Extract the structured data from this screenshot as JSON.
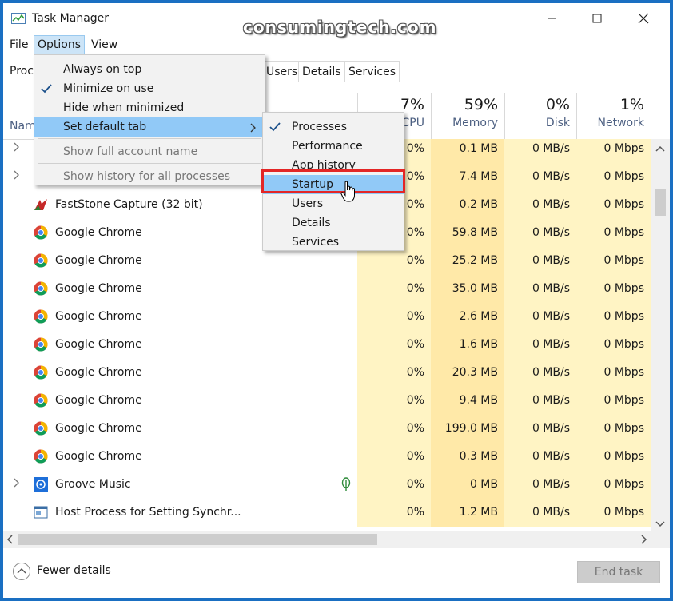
{
  "window": {
    "title": "Task Manager"
  },
  "watermark": "consumingtech.com",
  "menubar": {
    "file": "File",
    "options": "Options",
    "view": "View"
  },
  "tabs": [
    "Proc",
    "Users",
    "Details",
    "Services"
  ],
  "columns": {
    "name": "Nam",
    "cpu": {
      "pct": "7%",
      "label": "CPU"
    },
    "memory": {
      "pct": "59%",
      "label": "Memory"
    },
    "disk": {
      "pct": "0%",
      "label": "Disk"
    },
    "network": {
      "pct": "1%",
      "label": "Network"
    }
  },
  "rows": [
    {
      "name": "",
      "cpu": "0%",
      "mem": "0.1 MB",
      "disk": "0 MB/s",
      "net": "0 Mbps",
      "icon": "",
      "expand": true
    },
    {
      "name": "",
      "cpu": "0%",
      "mem": "7.4 MB",
      "disk": "0 MB/s",
      "net": "0 Mbps",
      "icon": "",
      "expand": true
    },
    {
      "name": "FastStone Capture (32 bit)",
      "cpu": "0%",
      "mem": "0.2 MB",
      "disk": "0 MB/s",
      "net": "0 Mbps",
      "icon": "faststone-icon",
      "expand": false
    },
    {
      "name": "Google Chrome",
      "cpu": "0%",
      "mem": "59.8 MB",
      "disk": "0 MB/s",
      "net": "0 Mbps",
      "icon": "chrome-icon",
      "expand": false
    },
    {
      "name": "Google Chrome",
      "cpu": "0%",
      "mem": "25.2 MB",
      "disk": "0 MB/s",
      "net": "0 Mbps",
      "icon": "chrome-icon",
      "expand": false
    },
    {
      "name": "Google Chrome",
      "cpu": "0%",
      "mem": "35.0 MB",
      "disk": "0 MB/s",
      "net": "0 Mbps",
      "icon": "chrome-icon",
      "expand": false
    },
    {
      "name": "Google Chrome",
      "cpu": "0%",
      "mem": "2.6 MB",
      "disk": "0 MB/s",
      "net": "0 Mbps",
      "icon": "chrome-icon",
      "expand": false
    },
    {
      "name": "Google Chrome",
      "cpu": "0%",
      "mem": "1.6 MB",
      "disk": "0 MB/s",
      "net": "0 Mbps",
      "icon": "chrome-icon",
      "expand": false
    },
    {
      "name": "Google Chrome",
      "cpu": "0%",
      "mem": "20.3 MB",
      "disk": "0 MB/s",
      "net": "0 Mbps",
      "icon": "chrome-icon",
      "expand": false
    },
    {
      "name": "Google Chrome",
      "cpu": "0%",
      "mem": "9.4 MB",
      "disk": "0 MB/s",
      "net": "0 Mbps",
      "icon": "chrome-icon",
      "expand": false
    },
    {
      "name": "Google Chrome",
      "cpu": "0%",
      "mem": "199.0 MB",
      "disk": "0 MB/s",
      "net": "0 Mbps",
      "icon": "chrome-icon",
      "expand": false
    },
    {
      "name": "Google Chrome",
      "cpu": "0%",
      "mem": "0.3 MB",
      "disk": "0 MB/s",
      "net": "0 Mbps",
      "icon": "chrome-icon",
      "expand": false
    },
    {
      "name": "Groove Music",
      "cpu": "0%",
      "mem": "0 MB",
      "disk": "0 MB/s",
      "net": "0 Mbps",
      "icon": "groove-icon",
      "expand": true,
      "leaf": true
    },
    {
      "name": "Host Process for Setting Synchr...",
      "cpu": "0%",
      "mem": "1.2 MB",
      "disk": "0 MB/s",
      "net": "0 Mbps",
      "icon": "host-process-icon",
      "expand": false
    }
  ],
  "options_menu": {
    "items": [
      {
        "label": "Always on top",
        "checked": false,
        "disabled": false
      },
      {
        "label": "Minimize on use",
        "checked": true,
        "disabled": false
      },
      {
        "label": "Hide when minimized",
        "checked": false,
        "disabled": false
      },
      {
        "label": "Set default tab",
        "checked": false,
        "disabled": false,
        "submenu": true,
        "highlighted": true
      },
      {
        "label": "Show full account name",
        "checked": false,
        "disabled": true
      },
      {
        "label": "Show history for all processes",
        "checked": false,
        "disabled": true
      }
    ]
  },
  "submenu": {
    "items": [
      {
        "label": "Processes",
        "checked": true
      },
      {
        "label": "Performance",
        "checked": false
      },
      {
        "label": "App history",
        "checked": false
      },
      {
        "label": "Startup",
        "checked": false,
        "highlighted": true
      },
      {
        "label": "Users",
        "checked": false
      },
      {
        "label": "Details",
        "checked": false
      },
      {
        "label": "Services",
        "checked": false
      }
    ]
  },
  "footer": {
    "fewer_details": "Fewer details",
    "end_task": "End task"
  },
  "colors": {
    "accent": "#1a6fc2",
    "cpu_col": "#fff4c4",
    "mem_col": "#ffe9a8",
    "highlight": "#91c9f7",
    "red_box": "#e32626"
  }
}
